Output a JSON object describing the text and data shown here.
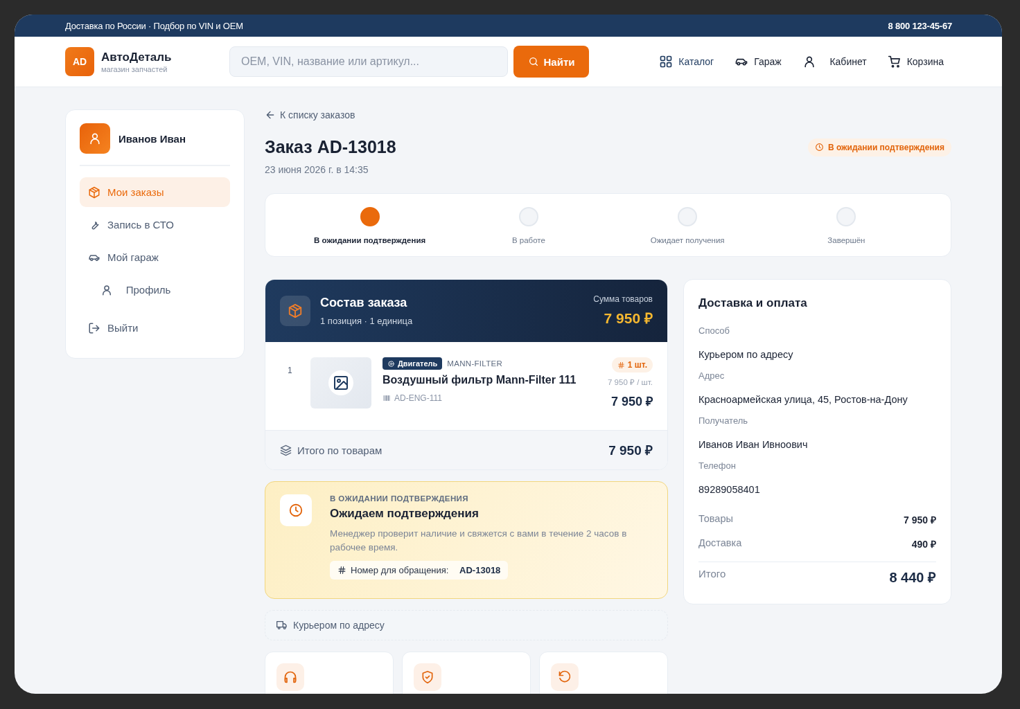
{
  "top_bar": {
    "text": "Доставка по России · Подбор по VIN и OEM",
    "phone": "8 800 123-45-67"
  },
  "header": {
    "logo": {
      "badge": "AD",
      "name": "АвтоДеталь",
      "tagline": "магазин запчастей"
    },
    "search": {
      "placeholder": "OEM, VIN, название или артикул...",
      "button": "Найти"
    },
    "nav": [
      {
        "label": "Каталог"
      },
      {
        "label": "Гараж"
      },
      {
        "label": "Кабинет"
      },
      {
        "label": "Корзина"
      }
    ]
  },
  "sidebar": {
    "user": "Иванов Иван",
    "items": [
      {
        "label": "Мои заказы",
        "selected": true
      },
      {
        "label": "Запись в СТО",
        "selected": false
      },
      {
        "label": "Мой гараж",
        "selected": false
      },
      {
        "label": "Профиль",
        "selected": false
      }
    ],
    "logout": "Выйти"
  },
  "order": {
    "back": "К списку заказов",
    "title": "Заказ AD-13018",
    "date": "23 июня 2026 г. в 14:35",
    "status": "В ожидании подтверждения",
    "steps": [
      {
        "label": "В ожидании подтверждения",
        "active": true
      },
      {
        "label": "В работе",
        "active": false
      },
      {
        "label": "Ожидает получения",
        "active": false
      },
      {
        "label": "Завершён",
        "active": false
      }
    ],
    "composition": {
      "title": "Состав заказа",
      "subtitle": "1 позиция · 1 единица",
      "sum_label": "Сумма товаров",
      "sum": "7 950 ₽",
      "items": [
        {
          "index": "1",
          "category": "Двигатель",
          "brand": "MANN-FILTER",
          "name": "Воздушный фильтр Mann-Filter 111",
          "sku": "AD-ENG-111",
          "quantity": "1 шт.",
          "unit_price": "7 950 ₽ / шт.",
          "price": "7 950 ₽"
        }
      ],
      "total_label": "Итого по товарам",
      "total": "7 950 ₽"
    },
    "notice": {
      "eyebrow": "В ОЖИДАНИИ ПОДТВЕРЖДЕНИЯ",
      "title": "Ожидаем подтверждения",
      "text": "Менеджер проверит наличие и свяжется с вами в течение 2 часов в рабочее время.",
      "reference_label": "Номер для обращения:",
      "reference": "AD-13018"
    },
    "delivery_method": "Курьером по адресу"
  },
  "delivery": {
    "title": "Доставка и оплата",
    "fields": [
      {
        "label": "Способ",
        "value": "Курьером по адресу"
      },
      {
        "label": "Адрес",
        "value": "Красноармейская улица, 45, Ростов-на-Дону"
      },
      {
        "label": "Получатель",
        "value": "Иванов Иван Ивноович"
      },
      {
        "label": "Телефон",
        "value": "89289058401"
      }
    ],
    "summary": [
      {
        "label": "Товары",
        "value": "7 950 ₽"
      },
      {
        "label": "Доставка",
        "value": "490 ₽"
      }
    ],
    "total": {
      "label": "Итого",
      "value": "8 440 ₽"
    }
  }
}
